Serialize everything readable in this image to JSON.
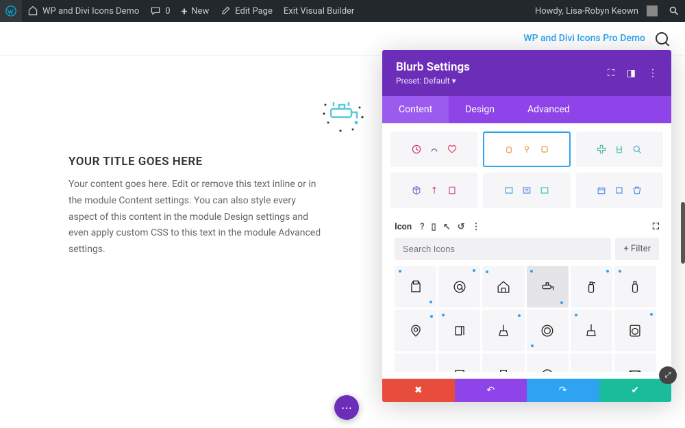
{
  "adminbar": {
    "site_title": "WP and Divi Icons Demo",
    "comments": "0",
    "new_label": "New",
    "edit_page": "Edit Page",
    "exit_vb": "Exit Visual Builder",
    "howdy": "Howdy, Lisa-Robyn Keown"
  },
  "header": {
    "link": "WP and Divi Icons Pro Demo"
  },
  "blurb": {
    "title": "YOUR TITLE GOES HERE",
    "text": "Your content goes here. Edit or remove this text inline or in the module Content settings. You can also style every aspect of this content in the module Design settings and even apply custom CSS to this text in the module Advanced settings."
  },
  "panel": {
    "title": "Blurb Settings",
    "preset": "Preset: Default",
    "tabs": {
      "content": "Content",
      "design": "Design",
      "advanced": "Advanced"
    },
    "icon_label": "Icon",
    "help": "?",
    "search_placeholder": "Search Icons",
    "filter": "+  Filter"
  }
}
